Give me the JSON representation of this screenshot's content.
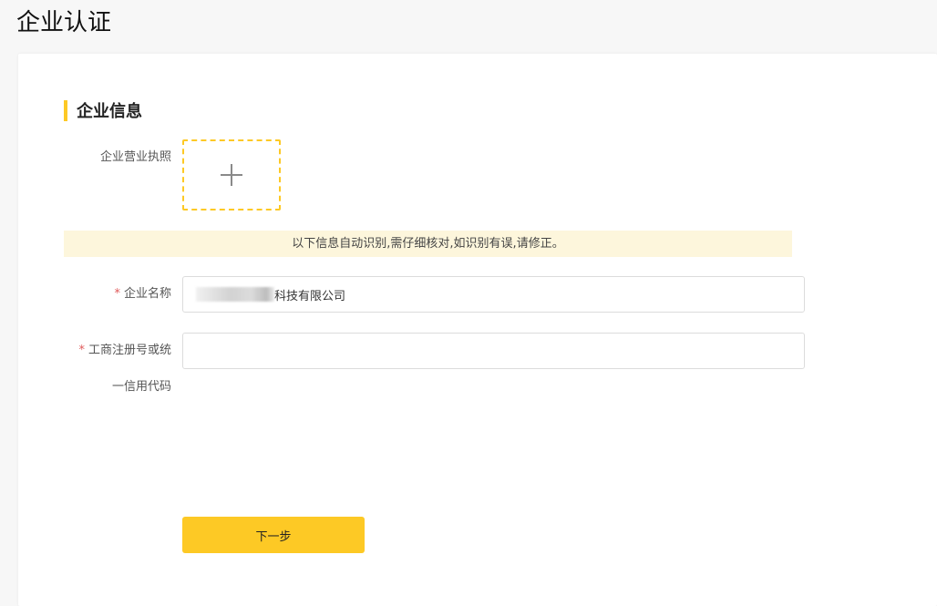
{
  "page": {
    "title": "企业认证"
  },
  "section": {
    "title": "企业信息"
  },
  "license": {
    "label": "企业营业执照"
  },
  "notice": {
    "text": "以下信息自动识别,需仔细核对,如识别有误,请修正。"
  },
  "company_name": {
    "required_mark": "*",
    "label": "企业名称",
    "value_visible_suffix": "科技有限公司"
  },
  "registration_code": {
    "required_mark": "*",
    "label_line1": "工商注册号或统",
    "label_line2": "一信用代码",
    "value": "",
    "placeholder": ""
  },
  "actions": {
    "next_label": "下一步"
  },
  "colors": {
    "accent": "#fdc925",
    "notice_bg": "#fdf6dc",
    "required": "#e05a5a"
  },
  "icons": {
    "upload": "plus-icon"
  }
}
